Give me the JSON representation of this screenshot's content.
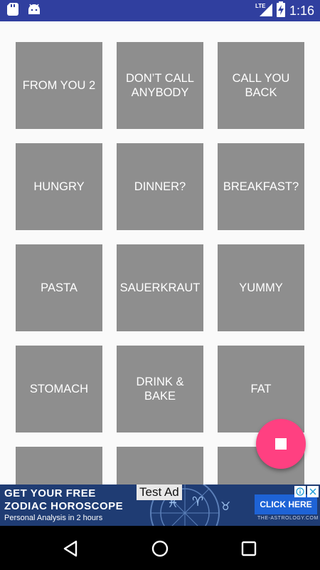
{
  "status_bar": {
    "time": "1:16",
    "network": "LTE",
    "icons": [
      "sd-card-icon",
      "android-icon",
      "lte-signal-icon",
      "battery-charging-icon"
    ]
  },
  "grid": {
    "tiles": [
      "FROM YOU 2",
      "DON’T CALL ANYBODY",
      "CALL YOU BACK",
      "HUNGRY",
      "DINNER?",
      "BREAKFAST?",
      "PASTA",
      "SAUERKRAUT",
      "YUMMY",
      "STOMACH",
      "DRINK & BAKE",
      "FAT",
      "",
      "",
      ""
    ]
  },
  "fab": {
    "icon": "stop-icon",
    "color": "#ff4081"
  },
  "ad": {
    "test_label": "Test Ad",
    "line1": "GET YOUR FREE",
    "line2": "ZODIAC HOROSCOPE",
    "line3": "Personal Analysis in 2 hours",
    "cta": "CLICK HERE",
    "domain": "THE-ASTROLOGY.COM",
    "icons": [
      "ad-choices-icon",
      "close-icon"
    ]
  },
  "nav_bar": {
    "buttons": [
      "back-icon",
      "home-icon",
      "recents-icon"
    ]
  },
  "colors": {
    "status_bar": "#303f9f",
    "tile": "#8e8e8e",
    "fab": "#ff4081",
    "background": "#fafafa"
  }
}
